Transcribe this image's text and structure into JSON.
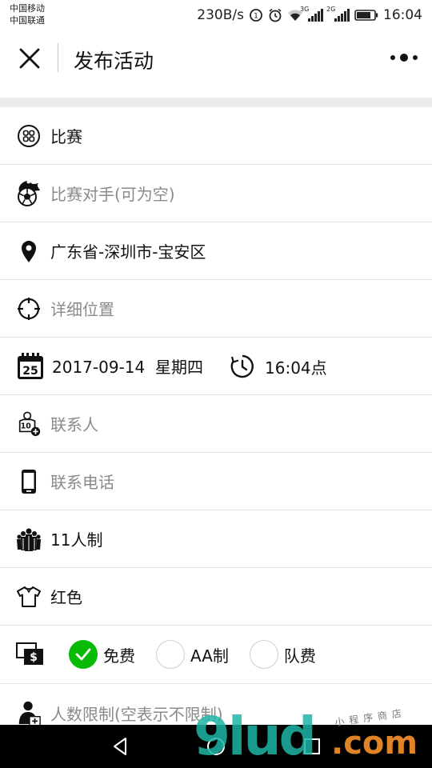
{
  "status_bar": {
    "carrier_1": "中国移动",
    "carrier_2": "中国联通",
    "net_speed": "230B/s",
    "sim1_network": "3G",
    "sim2_network": "2G",
    "time": "16:04"
  },
  "title_bar": {
    "title": "发布活动"
  },
  "form": {
    "match_type": "比赛",
    "opponent_placeholder": "比赛对手(可为空)",
    "region": "广东省-深圳市-宝安区",
    "address_placeholder": "详细位置",
    "date": "2017-09-14",
    "weekday": "星期四",
    "time": "16:04点",
    "calendar_day": "25",
    "contact_placeholder": "联系人",
    "jersey_number": "10",
    "phone_placeholder": "联系电话",
    "team_size": "11人制",
    "jersey_color": "红色",
    "fee_options": [
      {
        "label": "免费",
        "selected": true
      },
      {
        "label": "AA制",
        "selected": false
      },
      {
        "label": "队费",
        "selected": false
      }
    ],
    "fee_icon_symbol": "$",
    "limit_placeholder": "人数限制(空表示不限制)"
  },
  "watermark": {
    "brand": "9lud",
    "suffix": ".com",
    "tagline": "小程序商店"
  },
  "colors": {
    "accent_green": "#09bb07",
    "placeholder_gray": "#8a8a8a",
    "divider": "#e2e2e2",
    "band_gray": "#ebebeb"
  },
  "icons": [
    "close-icon",
    "more-icon",
    "grid-icon",
    "fire-ball-icon",
    "location-pin-icon",
    "crosshair-icon",
    "calendar-icon",
    "clock-icon",
    "jersey-person-icon",
    "phone-icon",
    "team-icon",
    "shirt-icon",
    "money-icon",
    "check-icon",
    "person-add-icon",
    "back-nav-icon",
    "home-nav-icon",
    "recents-nav-icon"
  ]
}
